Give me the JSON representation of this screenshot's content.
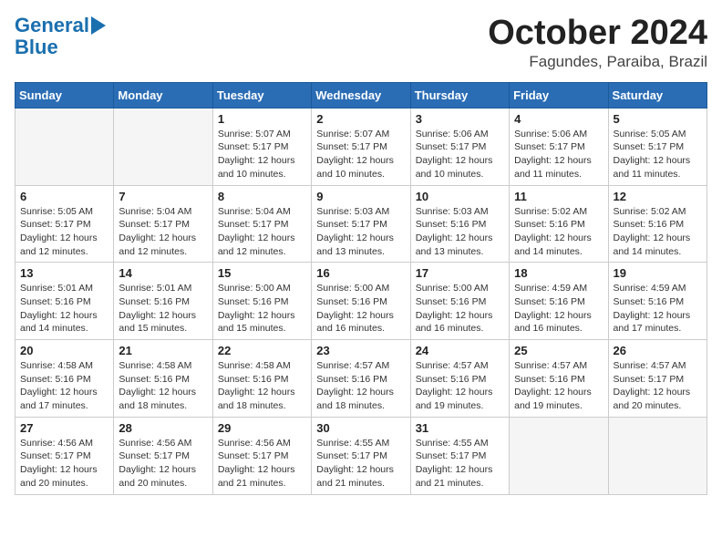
{
  "header": {
    "logo_line1": "General",
    "logo_line2": "Blue",
    "month": "October 2024",
    "location": "Fagundes, Paraiba, Brazil"
  },
  "weekdays": [
    "Sunday",
    "Monday",
    "Tuesday",
    "Wednesday",
    "Thursday",
    "Friday",
    "Saturday"
  ],
  "weeks": [
    [
      {
        "day": "",
        "info": ""
      },
      {
        "day": "",
        "info": ""
      },
      {
        "day": "1",
        "info": "Sunrise: 5:07 AM\nSunset: 5:17 PM\nDaylight: 12 hours and 10 minutes."
      },
      {
        "day": "2",
        "info": "Sunrise: 5:07 AM\nSunset: 5:17 PM\nDaylight: 12 hours and 10 minutes."
      },
      {
        "day": "3",
        "info": "Sunrise: 5:06 AM\nSunset: 5:17 PM\nDaylight: 12 hours and 10 minutes."
      },
      {
        "day": "4",
        "info": "Sunrise: 5:06 AM\nSunset: 5:17 PM\nDaylight: 12 hours and 11 minutes."
      },
      {
        "day": "5",
        "info": "Sunrise: 5:05 AM\nSunset: 5:17 PM\nDaylight: 12 hours and 11 minutes."
      }
    ],
    [
      {
        "day": "6",
        "info": "Sunrise: 5:05 AM\nSunset: 5:17 PM\nDaylight: 12 hours and 12 minutes."
      },
      {
        "day": "7",
        "info": "Sunrise: 5:04 AM\nSunset: 5:17 PM\nDaylight: 12 hours and 12 minutes."
      },
      {
        "day": "8",
        "info": "Sunrise: 5:04 AM\nSunset: 5:17 PM\nDaylight: 12 hours and 12 minutes."
      },
      {
        "day": "9",
        "info": "Sunrise: 5:03 AM\nSunset: 5:17 PM\nDaylight: 12 hours and 13 minutes."
      },
      {
        "day": "10",
        "info": "Sunrise: 5:03 AM\nSunset: 5:16 PM\nDaylight: 12 hours and 13 minutes."
      },
      {
        "day": "11",
        "info": "Sunrise: 5:02 AM\nSunset: 5:16 PM\nDaylight: 12 hours and 14 minutes."
      },
      {
        "day": "12",
        "info": "Sunrise: 5:02 AM\nSunset: 5:16 PM\nDaylight: 12 hours and 14 minutes."
      }
    ],
    [
      {
        "day": "13",
        "info": "Sunrise: 5:01 AM\nSunset: 5:16 PM\nDaylight: 12 hours and 14 minutes."
      },
      {
        "day": "14",
        "info": "Sunrise: 5:01 AM\nSunset: 5:16 PM\nDaylight: 12 hours and 15 minutes."
      },
      {
        "day": "15",
        "info": "Sunrise: 5:00 AM\nSunset: 5:16 PM\nDaylight: 12 hours and 15 minutes."
      },
      {
        "day": "16",
        "info": "Sunrise: 5:00 AM\nSunset: 5:16 PM\nDaylight: 12 hours and 16 minutes."
      },
      {
        "day": "17",
        "info": "Sunrise: 5:00 AM\nSunset: 5:16 PM\nDaylight: 12 hours and 16 minutes."
      },
      {
        "day": "18",
        "info": "Sunrise: 4:59 AM\nSunset: 5:16 PM\nDaylight: 12 hours and 16 minutes."
      },
      {
        "day": "19",
        "info": "Sunrise: 4:59 AM\nSunset: 5:16 PM\nDaylight: 12 hours and 17 minutes."
      }
    ],
    [
      {
        "day": "20",
        "info": "Sunrise: 4:58 AM\nSunset: 5:16 PM\nDaylight: 12 hours and 17 minutes."
      },
      {
        "day": "21",
        "info": "Sunrise: 4:58 AM\nSunset: 5:16 PM\nDaylight: 12 hours and 18 minutes."
      },
      {
        "day": "22",
        "info": "Sunrise: 4:58 AM\nSunset: 5:16 PM\nDaylight: 12 hours and 18 minutes."
      },
      {
        "day": "23",
        "info": "Sunrise: 4:57 AM\nSunset: 5:16 PM\nDaylight: 12 hours and 18 minutes."
      },
      {
        "day": "24",
        "info": "Sunrise: 4:57 AM\nSunset: 5:16 PM\nDaylight: 12 hours and 19 minutes."
      },
      {
        "day": "25",
        "info": "Sunrise: 4:57 AM\nSunset: 5:16 PM\nDaylight: 12 hours and 19 minutes."
      },
      {
        "day": "26",
        "info": "Sunrise: 4:57 AM\nSunset: 5:17 PM\nDaylight: 12 hours and 20 minutes."
      }
    ],
    [
      {
        "day": "27",
        "info": "Sunrise: 4:56 AM\nSunset: 5:17 PM\nDaylight: 12 hours and 20 minutes."
      },
      {
        "day": "28",
        "info": "Sunrise: 4:56 AM\nSunset: 5:17 PM\nDaylight: 12 hours and 20 minutes."
      },
      {
        "day": "29",
        "info": "Sunrise: 4:56 AM\nSunset: 5:17 PM\nDaylight: 12 hours and 21 minutes."
      },
      {
        "day": "30",
        "info": "Sunrise: 4:55 AM\nSunset: 5:17 PM\nDaylight: 12 hours and 21 minutes."
      },
      {
        "day": "31",
        "info": "Sunrise: 4:55 AM\nSunset: 5:17 PM\nDaylight: 12 hours and 21 minutes."
      },
      {
        "day": "",
        "info": ""
      },
      {
        "day": "",
        "info": ""
      }
    ]
  ]
}
